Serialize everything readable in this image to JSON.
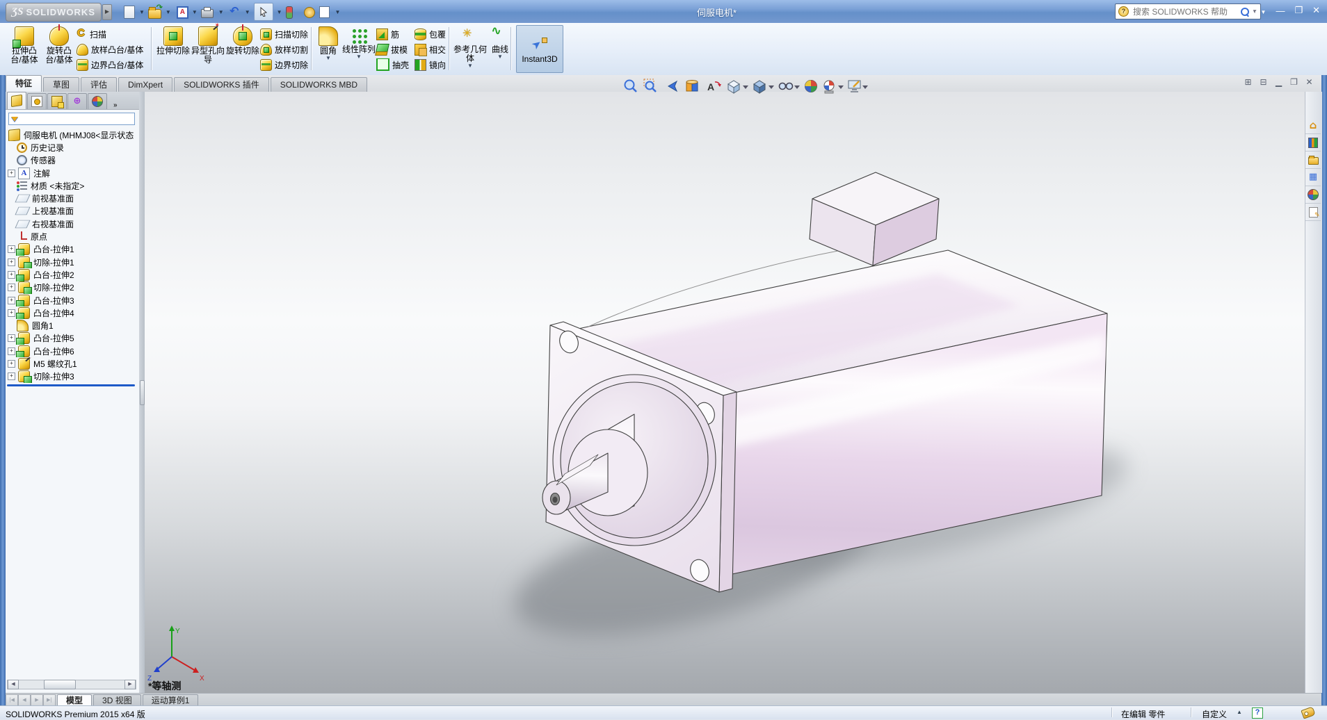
{
  "titlebar": {
    "logo_mark": "ƷS",
    "logo": "SOLIDWORKS",
    "title": "伺服电机*",
    "search_placeholder": "搜索 SOLIDWORKS 帮助"
  },
  "ribbon": {
    "extrude_boss": "拉伸凸台/基体",
    "revolve_boss": "旋转凸台/基体",
    "sweep": "扫描",
    "loft": "放样凸台/基体",
    "boundary_boss": "边界凸台/基体",
    "extrude_cut": "拉伸切除",
    "hole_wizard": "异型孔向导",
    "revolve_cut": "旋转切除",
    "sweep_cut": "扫描切除",
    "loft_cut": "放样切割",
    "boundary_cut": "边界切除",
    "fillet": "圆角",
    "linear_pattern": "线性阵列",
    "rib": "筋",
    "draft": "拔模",
    "shell": "抽壳",
    "wrap": "包覆",
    "intersect": "相交",
    "mirror": "镜向",
    "reference_geometry": "参考几何体",
    "curves": "曲线",
    "instant3d": "Instant3D"
  },
  "tabs": {
    "features": "特征",
    "sketch": "草图",
    "evaluate": "评估",
    "dimxpert": "DimXpert",
    "addins": "SOLIDWORKS 插件",
    "mbd": "SOLIDWORKS MBD"
  },
  "tree": {
    "root": "伺服电机 (MHMJ08<显示状态",
    "items": [
      "历史记录",
      "传感器",
      "注解",
      "材质 <未指定>",
      "前视基准面",
      "上视基准面",
      "右视基准面",
      "原点",
      "凸台-拉伸1",
      "切除-拉伸1",
      "凸台-拉伸2",
      "切除-拉伸2",
      "凸台-拉伸3",
      "凸台-拉伸4",
      "圆角1",
      "凸台-拉伸5",
      "凸台-拉伸6",
      "M5 螺纹孔1",
      "切除-拉伸3"
    ]
  },
  "viewport": {
    "view_name": "*等轴测",
    "triad": {
      "x": "X",
      "y": "Y",
      "z": "Z"
    }
  },
  "bottom_tabs": {
    "model": "模型",
    "view3d": "3D 视图",
    "motion": "运动算例1"
  },
  "statusbar": {
    "product": "SOLIDWORKS Premium 2015 x64 版",
    "editing": "在编辑 零件",
    "custom": "自定义"
  }
}
